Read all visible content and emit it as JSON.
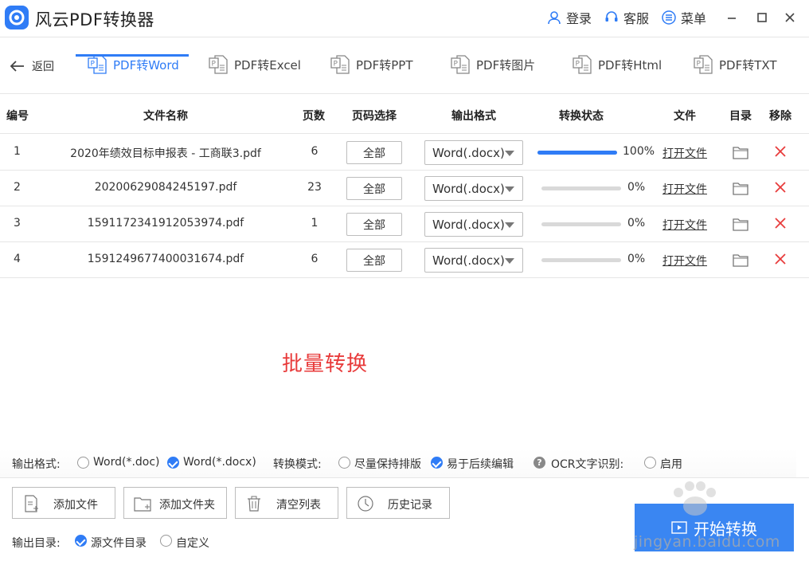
{
  "app": {
    "title": "风云PDF转换器",
    "login": "登录",
    "service": "客服",
    "menu": "菜单"
  },
  "nav": {
    "back_label": "返回",
    "tabs": [
      {
        "label": "PDF转Word",
        "active": true
      },
      {
        "label": "PDF转Excel",
        "active": false
      },
      {
        "label": "PDF转PPT",
        "active": false
      },
      {
        "label": "PDF转图片",
        "active": false
      },
      {
        "label": "PDF转Html",
        "active": false
      },
      {
        "label": "PDF转TXT",
        "active": false
      }
    ]
  },
  "table": {
    "headers": [
      "编号",
      "文件名称",
      "页数",
      "页码选择",
      "输出格式",
      "转换状态",
      "文件",
      "目录",
      "移除"
    ],
    "rows": [
      {
        "num": "1",
        "name": "2020年绩效目标申报表 - 工商联3.pdf",
        "pages": "6",
        "page_select": "全部",
        "format": "Word(.docx)",
        "progress": 100,
        "progress_text": "100%",
        "open": "打开文件"
      },
      {
        "num": "2",
        "name": "20200629084245197.pdf",
        "pages": "23",
        "page_select": "全部",
        "format": "Word(.docx)",
        "progress": 0,
        "progress_text": "0%",
        "open": "打开文件"
      },
      {
        "num": "3",
        "name": "1591172341912053974.pdf",
        "pages": "1",
        "page_select": "全部",
        "format": "Word(.docx)",
        "progress": 0,
        "progress_text": "0%",
        "open": "打开文件"
      },
      {
        "num": "4",
        "name": "1591249677400031674.pdf",
        "pages": "6",
        "page_select": "全部",
        "format": "Word(.docx)",
        "progress": 0,
        "progress_text": "0%",
        "open": "打开文件"
      }
    ]
  },
  "annotation": "批量转换",
  "options": {
    "format_label": "输出格式:",
    "format_doc": "Word(*.doc)",
    "format_docx": "Word(*.docx)",
    "mode_label": "转换模式:",
    "mode_layout": "尽量保持排版",
    "mode_edit": "易于后续编辑",
    "ocr_label": "OCR文字识别:",
    "ocr_enable": "启用"
  },
  "actions": {
    "add_file": "添加文件",
    "add_folder": "添加文件夹",
    "clear_list": "清空列表",
    "history": "历史记录",
    "start": "开始转换"
  },
  "output_dir": {
    "label": "输出目录:",
    "source": "源文件目录",
    "custom": "自定义"
  },
  "watermark": {
    "url": "jingyan.baidu.com"
  },
  "colors": {
    "accent": "#2f7cf6",
    "remove": "#e83b3b"
  }
}
